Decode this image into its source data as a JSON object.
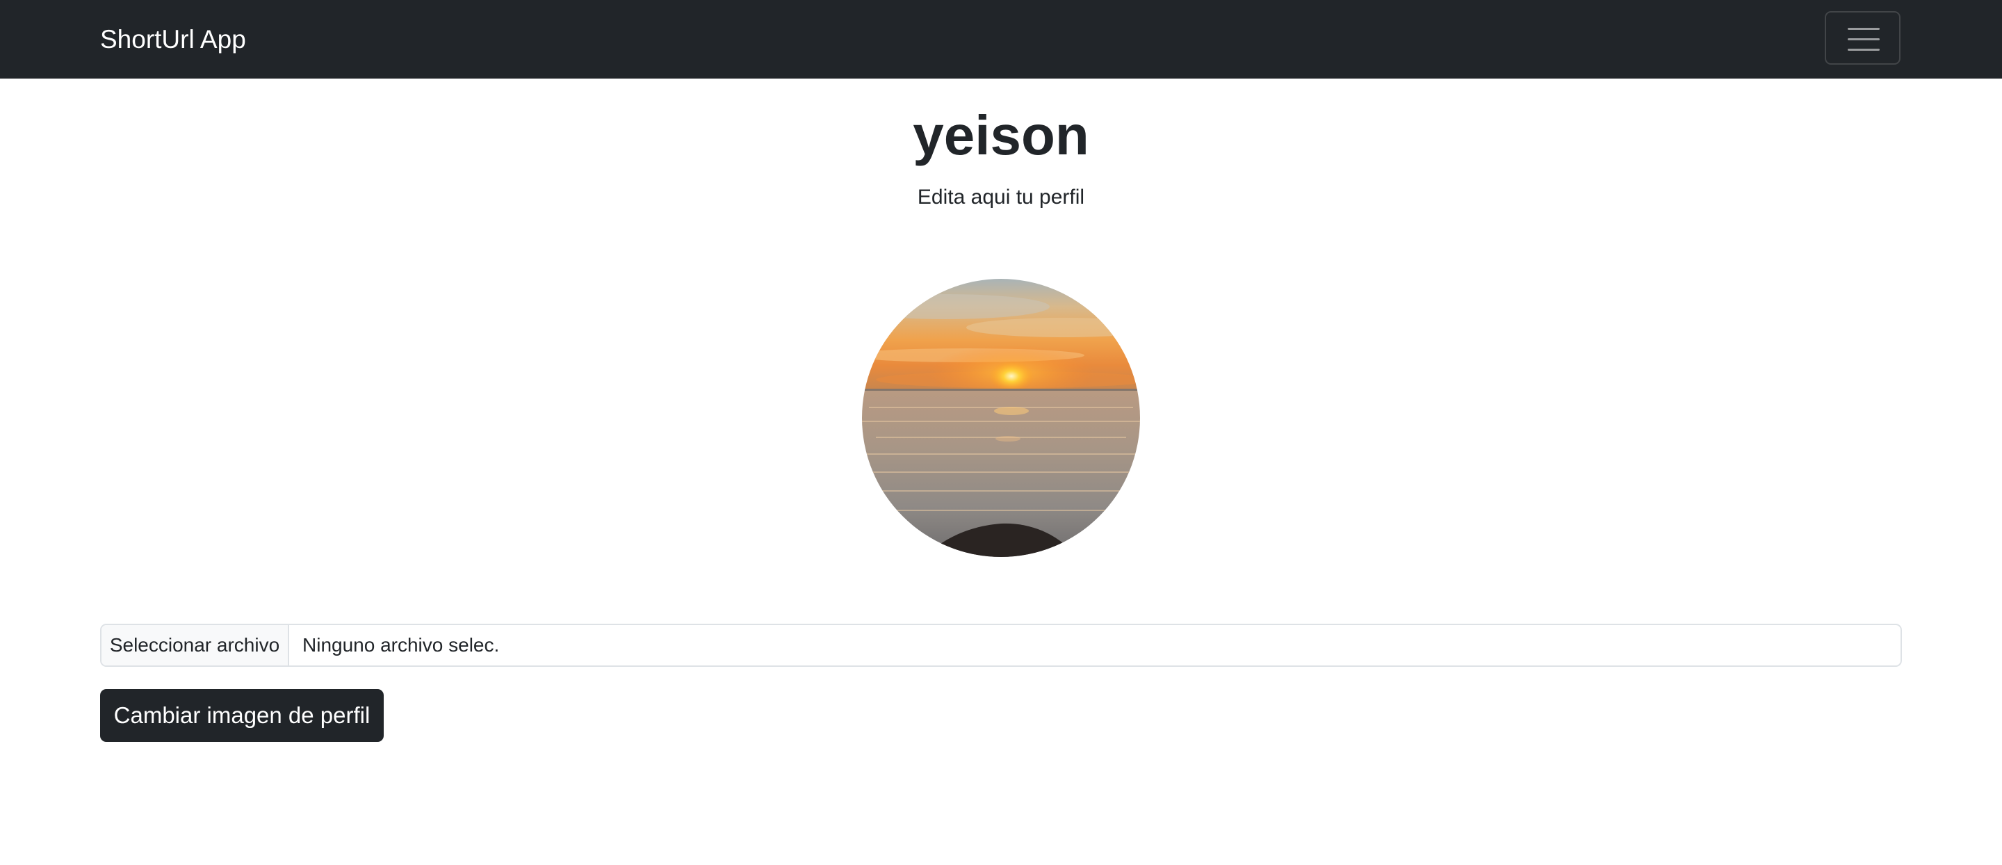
{
  "navbar": {
    "brand": "ShortUrl App",
    "toggler_icon": "hamburger-menu-icon"
  },
  "profile": {
    "username": "yeison",
    "subtitle": "Edita aqui tu perfil",
    "avatar_description": "sunset-over-sea"
  },
  "upload": {
    "file_button_label": "Seleccionar archivo",
    "file_status": "Ninguno archivo selec.",
    "submit_label": "Cambiar imagen de perfil"
  },
  "colors": {
    "navbar_bg": "#212529",
    "button_bg": "#212529",
    "text": "#212529",
    "border": "#dee2e6",
    "file_button_bg": "#f8f9fa"
  }
}
